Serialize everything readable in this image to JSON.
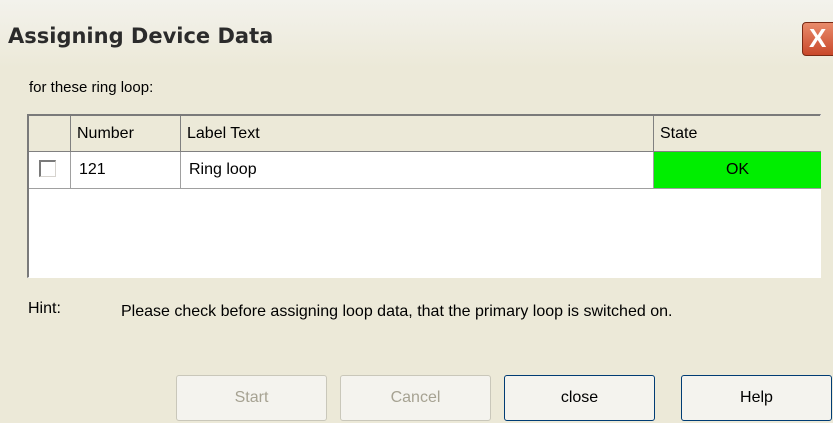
{
  "window": {
    "title": "Assigning Device Data",
    "close_glyph": "X"
  },
  "subtitle": "for these ring loop:",
  "table": {
    "columns": [
      "",
      "Number",
      "Label Text",
      "State"
    ],
    "rows": [
      {
        "checked": false,
        "number": "121",
        "label": "Ring loop",
        "state": "OK",
        "state_color": "#00ee00"
      }
    ]
  },
  "hint": {
    "label": "Hint:",
    "text": "Please check before assigning loop data, that the primary loop is switched on."
  },
  "buttons": {
    "start": "Start",
    "cancel": "Cancel",
    "close": "close",
    "help": "Help"
  }
}
